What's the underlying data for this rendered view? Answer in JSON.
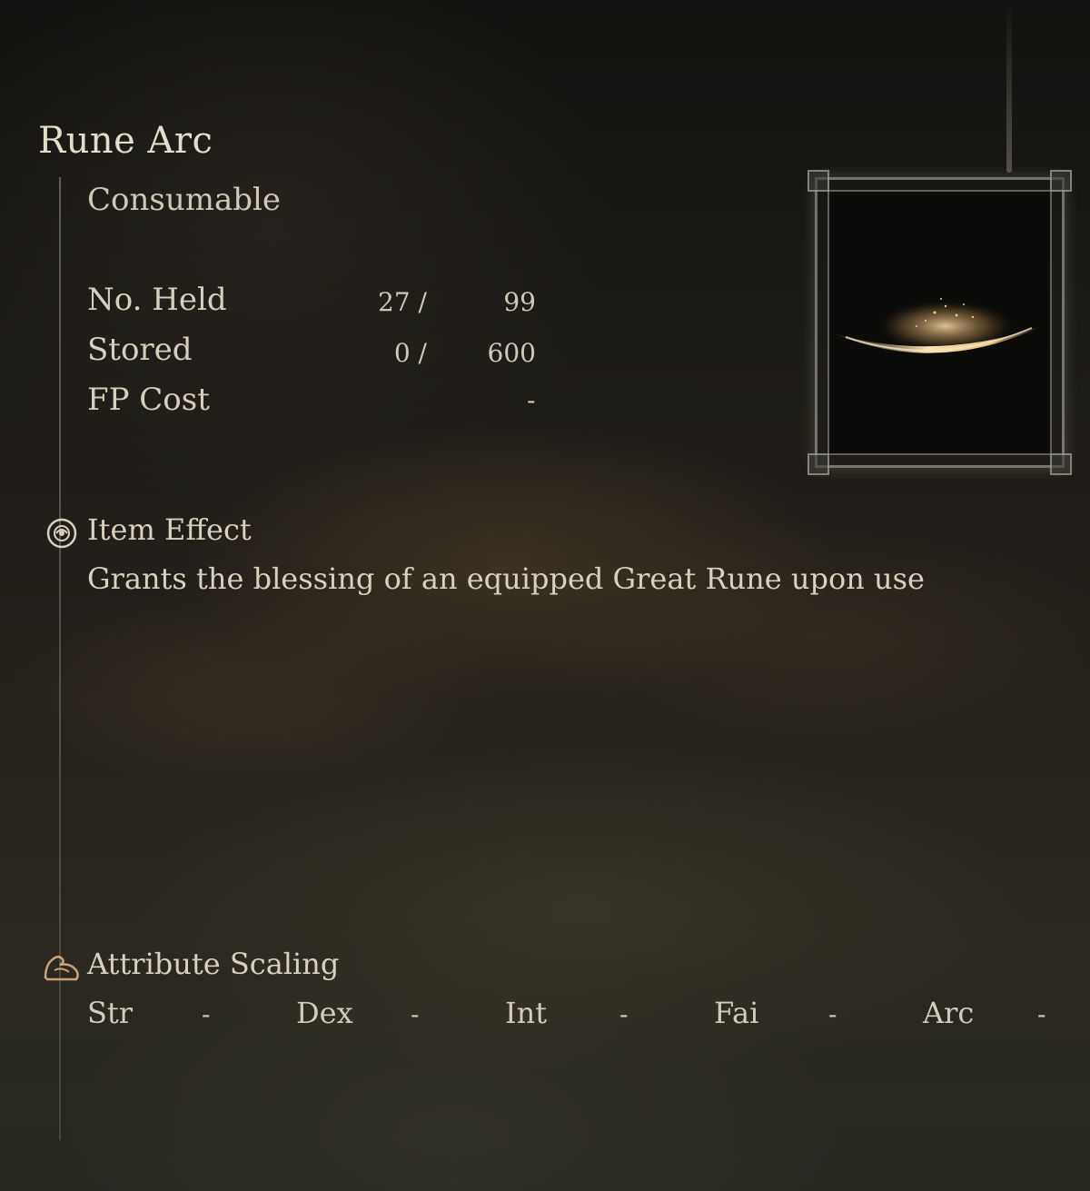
{
  "item": {
    "name": "Rune Arc",
    "category": "Consumable",
    "stats": [
      {
        "label": "No. Held",
        "current": "27 /",
        "max": "99"
      },
      {
        "label": "Stored",
        "current": "0 /",
        "max": "600"
      },
      {
        "label": "FP Cost",
        "value": "-"
      }
    ],
    "effect_heading": "Item Effect",
    "effect_text": "Grants the blessing of an equipped Great Rune upon use",
    "scaling_heading": "Attribute Scaling",
    "scaling": [
      {
        "name": "Str",
        "value": "-"
      },
      {
        "name": "Dex",
        "value": "-"
      },
      {
        "name": "Int",
        "value": "-"
      },
      {
        "name": "Fai",
        "value": "-"
      },
      {
        "name": "Arc",
        "value": "-"
      }
    ]
  },
  "icons": {
    "effect": "item-effect-icon",
    "scaling": "attribute-scaling-arm-icon",
    "item_image": "rune-arc-image"
  },
  "colors": {
    "text": "#d9d2c0",
    "glow": "#e8c88a"
  }
}
